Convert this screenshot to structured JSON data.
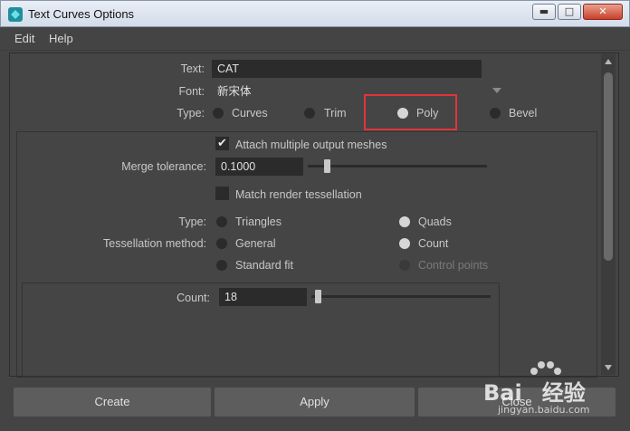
{
  "window": {
    "title": "Text Curves Options",
    "controls": {
      "minimize": "▬",
      "maximize": "□",
      "close": "✕"
    }
  },
  "menu": {
    "items": [
      "Edit",
      "Help"
    ]
  },
  "form": {
    "text_label": "Text:",
    "text_value": "CAT",
    "font_label": "Font:",
    "font_value": "新宋体",
    "type_label": "Type:",
    "type_options": [
      "Curves",
      "Trim",
      "Poly",
      "Bevel"
    ],
    "type_selected": "Poly",
    "attach_label": "Attach multiple output meshes",
    "attach_checked": true,
    "merge_label": "Merge tolerance:",
    "merge_value": "0.1000",
    "match_label": "Match render tessellation",
    "match_checked": false,
    "mesh_type_label": "Type:",
    "mesh_type_options": [
      "Triangles",
      "Quads"
    ],
    "mesh_type_selected": "Quads",
    "tess_label": "Tessellation method:",
    "tess_options": [
      "General",
      "Count",
      "Standard fit",
      "Control points"
    ],
    "tess_selected": "Count",
    "tess_disabled": [
      "Control points"
    ],
    "count_label": "Count:",
    "count_value": "18"
  },
  "footer": {
    "create": "Create",
    "apply": "Apply",
    "close": "Close"
  },
  "watermark": {
    "brand": "Bai",
    "brand_cn": "经验",
    "url": "jingyan.baidu.com"
  },
  "colors": {
    "highlight": "#e0343a",
    "panel": "#444444",
    "field": "#2b2b2b"
  }
}
